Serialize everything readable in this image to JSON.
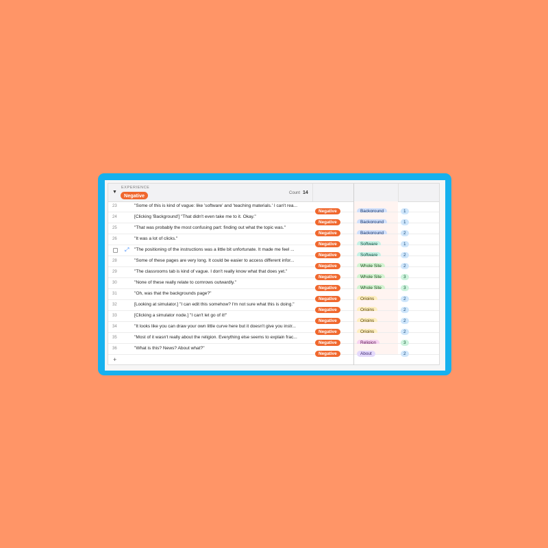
{
  "group": {
    "field_name": "EXPERIENCE",
    "value": "Negative",
    "count_label": "Count",
    "count": "14"
  },
  "add_record": "+",
  "rows": [
    {
      "id": "23",
      "quote": "\"Some of this is kind of vague: like 'software' and 'teaching materials.' I can't rea...",
      "tag": "Negative",
      "category": "Background",
      "cat_style": "blue",
      "num": "1",
      "num_style": "blue"
    },
    {
      "id": "24",
      "quote": "[Clicking 'Background'] \"That didn't even take me to it. Okay.\"",
      "tag": "Negative",
      "category": "Background",
      "cat_style": "blue",
      "num": "1",
      "num_style": "blue"
    },
    {
      "id": "25",
      "quote": "\"That was probably the most confusing part: finding out what the topic was.\"",
      "tag": "Negative",
      "category": "Background",
      "cat_style": "blue",
      "num": "2",
      "num_style": "blue"
    },
    {
      "id": "26",
      "quote": "\"It was a lot of clicks.\"",
      "tag": "Negative",
      "category": "Software",
      "cat_style": "teal",
      "num": "1",
      "num_style": "blue"
    },
    {
      "id": "",
      "quote": "\"The positioning of the instructions was a little bit unfortunate. It made me feel ...",
      "tag": "Negative",
      "category": "Software",
      "cat_style": "teal",
      "num": "2",
      "num_style": "blue",
      "hovered": true
    },
    {
      "id": "28",
      "quote": "\"Some of these pages are very long. It could be easier to access different infor...",
      "tag": "Negative",
      "category": "Whole Site",
      "cat_style": "green",
      "num": "2",
      "num_style": "blue"
    },
    {
      "id": "29",
      "quote": "\"The classrooms tab is kind of vague. I don't really know what that does yet.\"",
      "tag": "Negative",
      "category": "Whole Site",
      "cat_style": "green",
      "num": "3",
      "num_style": "green"
    },
    {
      "id": "30",
      "quote": "\"None of these really relate to cornrows outwardly.\"",
      "tag": "Negative",
      "category": "Whole Site",
      "cat_style": "green",
      "num": "3",
      "num_style": "green"
    },
    {
      "id": "31",
      "quote": "\"Oh, was that the backgrounds page?\"",
      "tag": "Negative",
      "category": "Origins",
      "cat_style": "yellow",
      "num": "2",
      "num_style": "blue"
    },
    {
      "id": "32",
      "quote": "[Looking at simulator.] \"I can edit this somehow? I'm not sure what this is doing.\"",
      "tag": "Negative",
      "category": "Origins",
      "cat_style": "yellow",
      "num": "2",
      "num_style": "blue"
    },
    {
      "id": "33",
      "quote": "[Clicking a simulator node.] \"I can't let go of it!\"",
      "tag": "Negative",
      "category": "Origins",
      "cat_style": "yellow",
      "num": "2",
      "num_style": "blue"
    },
    {
      "id": "34",
      "quote": "\"It looks like you can draw your own little curve here but it doesn't give you instr...",
      "tag": "Negative",
      "category": "Origins",
      "cat_style": "yellow",
      "num": "2",
      "num_style": "blue"
    },
    {
      "id": "35",
      "quote": "\"Most of it wasn't really about the religion. Everything else seems to explain frac...",
      "tag": "Negative",
      "category": "Religion",
      "cat_style": "pink",
      "num": "3",
      "num_style": "green"
    },
    {
      "id": "36",
      "quote": "\"What is this? News? About what?\"",
      "tag": "Negative",
      "category": "About",
      "cat_style": "purple",
      "num": "2",
      "num_style": "blue"
    }
  ]
}
